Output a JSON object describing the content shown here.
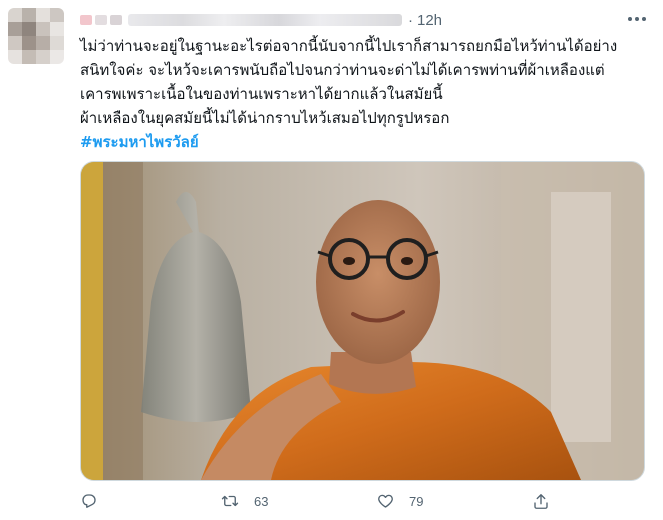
{
  "tweet": {
    "timestamp": "12h",
    "separator": "·",
    "text": "ไม่ว่าท่านจะอยู่ในฐานะอะไรต่อจากนี้นับจากนี้ไปเราก็สามารถยกมือไหว้ท่านได้อย่าง\nสนิทใจค่ะ จะไหว้จะเคารพนับถือไปจนกว่าท่านจะด่าไม่ได้เคารพท่านที่ผ้าเหลืองแต่\nเคารพเพราะเนื้อในของท่านเพราะหาได้ยากแล้วในสมัยนี้\nผ้าเหลืองในยุคสมัยนี้ไม่ได้น่ากราบไหว้เสมอไปทุกรูปหรอก",
    "hashtag": "#พระมหาไพรวัลย์"
  },
  "actions": {
    "reply_count": "",
    "retweet_count": "63",
    "like_count": "79"
  },
  "colors": {
    "link": "#1d9bf0",
    "secondary_text": "#536471",
    "robe": "#d9731f"
  },
  "icons": [
    "more-icon",
    "reply-icon",
    "retweet-icon",
    "like-icon",
    "share-icon"
  ]
}
